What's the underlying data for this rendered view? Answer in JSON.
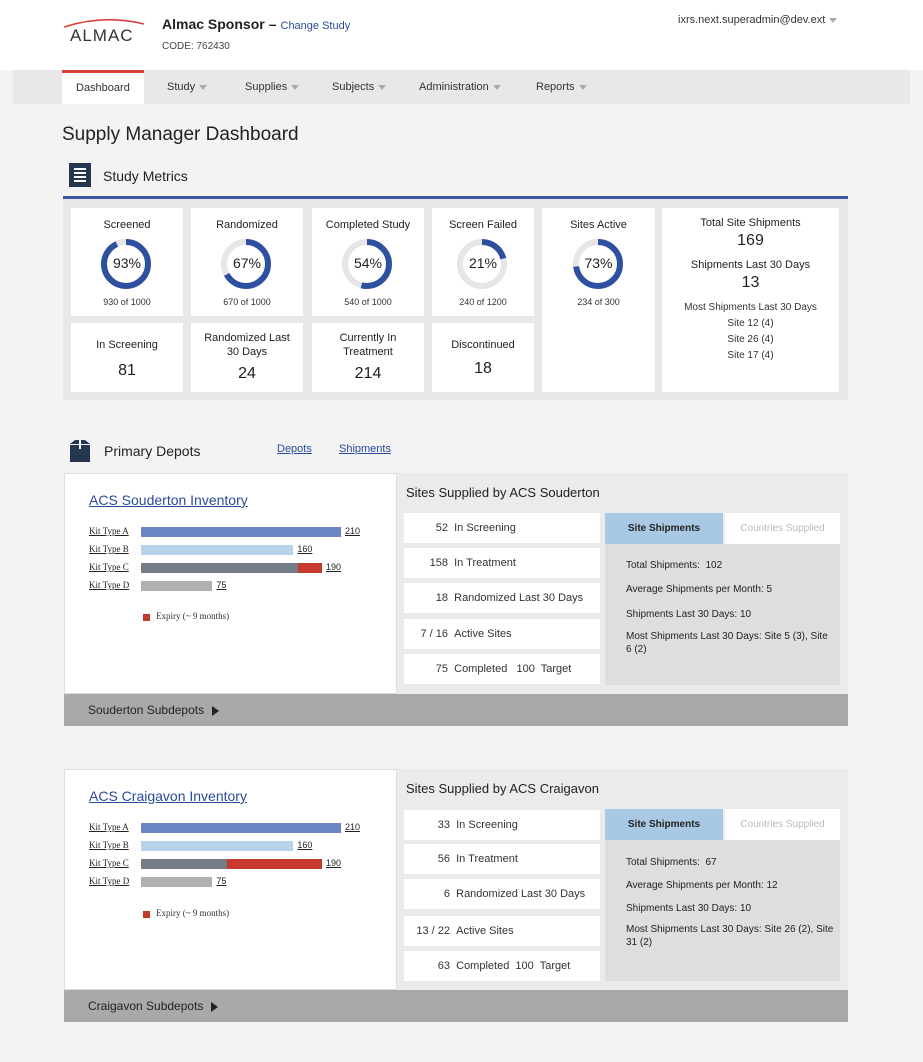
{
  "header": {
    "logo": "ALMAC",
    "sponsor": "Almac Sponsor",
    "dash": "–",
    "change_study": "Change Study",
    "code": "CODE: 762430",
    "user": "ixrs.next.superadmin@dev.ext"
  },
  "nav": [
    "Dashboard",
    "Study",
    "Supplies",
    "Subjects",
    "Administration",
    "Reports"
  ],
  "page_title": "Supply Manager Dashboard",
  "metrics": {
    "title": "Study Metrics",
    "rings": [
      {
        "label": "Screened",
        "pct_text": "93%",
        "pct": 0.93,
        "sub": "930 of 1000"
      },
      {
        "label": "Randomized",
        "pct_text": "67%",
        "pct": 0.67,
        "sub": "670 of 1000"
      },
      {
        "label": "Completed Study",
        "pct_text": "54%",
        "pct": 0.54,
        "sub": "540 of 1000"
      },
      {
        "label": "Screen Failed",
        "pct_text": "21%",
        "pct": 0.21,
        "sub": "240 of 1200"
      },
      {
        "label": "Sites Active",
        "pct_text": "73%",
        "pct": 0.73,
        "sub": "234 of 300"
      }
    ],
    "counts": [
      {
        "label": "In Screening",
        "value": "81"
      },
      {
        "label": "Randomized Last 30 Days",
        "value": "24"
      },
      {
        "label": "Currently In Treatment",
        "value": "214"
      },
      {
        "label": "Discontinued",
        "value": "18"
      }
    ],
    "shipments": {
      "total_label": "Total Site Shipments",
      "total": "169",
      "last30_label": "Shipments Last 30 Days",
      "last30": "13",
      "most_label": "Most Shipments Last 30 Days",
      "most": [
        "Site 12 (4)",
        "Site 26 (4)",
        "Site 17 (4)"
      ]
    }
  },
  "depots": {
    "title": "Primary Depots",
    "link_depots": "Depots",
    "link_shipments": "Shipments",
    "items": [
      {
        "inventory_title": "ACS Souderton Inventory",
        "kits": [
          {
            "label": "Kit Type A",
            "value": 210,
            "value_text": "210",
            "expiry": 0
          },
          {
            "label": "Kit Type B",
            "value": 160,
            "value_text": "160",
            "expiry": 0
          },
          {
            "label": "Kit Type C",
            "value": 190,
            "value_text": "190",
            "expiry": 25
          },
          {
            "label": "Kit Type D",
            "value": 75,
            "value_text": "75",
            "expiry": 0
          }
        ],
        "legend": "Expiry (~ 9 months)",
        "sites_title": "Sites Supplied by ACS Souderton",
        "rows": [
          {
            "num": "52",
            "label": "In Screening"
          },
          {
            "num": "158",
            "label": "In Treatment"
          },
          {
            "num": "18",
            "label": "Randomized Last 30 Days"
          },
          {
            "num": "7 / 16",
            "label": "Active Sites"
          },
          {
            "num": "75",
            "label": "Completed   100  Target"
          }
        ],
        "tab_on": "Site Shipments",
        "tab_off": "Countries Supplied",
        "ship": [
          "Total Shipments:  102",
          "Average Shipments per Month: 5",
          "Shipments Last 30 Days: 10",
          "Most Shipments Last 30 Days: Site 5 (3), Site 6 (2)"
        ],
        "subdepot": "Souderton Subdepots"
      },
      {
        "inventory_title": "ACS Craigavon Inventory",
        "kits": [
          {
            "label": "Kit Type A",
            "value": 210,
            "value_text": "210",
            "expiry": 0
          },
          {
            "label": "Kit Type B",
            "value": 160,
            "value_text": "160",
            "expiry": 0
          },
          {
            "label": "Kit Type C",
            "value": 190,
            "value_text": "190",
            "expiry": 100
          },
          {
            "label": "Kit Type D",
            "value": 75,
            "value_text": "75",
            "expiry": 0
          }
        ],
        "legend": "Expiry (~ 9 months)",
        "sites_title": "Sites Supplied by ACS Craigavon",
        "rows": [
          {
            "num": "33",
            "label": "In Screening"
          },
          {
            "num": "56",
            "label": "In Treatment"
          },
          {
            "num": "6",
            "label": "Randomized Last 30 Days"
          },
          {
            "num": "13 / 22",
            "label": "Active Sites"
          },
          {
            "num": "63",
            "label": "Completed  100  Target"
          }
        ],
        "tab_on": "Site Shipments",
        "tab_off": "Countries Supplied",
        "ship": [
          "Total Shipments:  67",
          "Average Shipments per Month: 12",
          "Shipments Last 30 Days: 10",
          "Most Shipments Last 30 Days: Site 26 (2), Site 31 (2)"
        ],
        "subdepot": "Craigavon Subdepots"
      }
    ]
  },
  "colors": {
    "accent_red": "#d9413b",
    "ring_blue": "#2f4fa0",
    "kit_a": "#6b84c4",
    "kit_b": "#b9d3ec",
    "kit_c": "#737b84",
    "kit_d": "#b0b0b0",
    "expiry": "#c63a2c"
  }
}
